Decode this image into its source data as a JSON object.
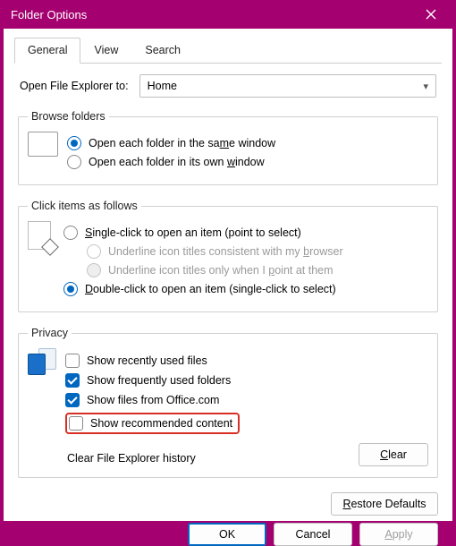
{
  "window": {
    "title": "Folder Options"
  },
  "tabs": {
    "general": "General",
    "view": "View",
    "search": "Search",
    "active": 0
  },
  "open_row": {
    "label": "Open File Explorer to:",
    "value": "Home"
  },
  "browse": {
    "legend": "Browse folders",
    "same_pre": "Open each folder in the sa",
    "same_u": "m",
    "same_post": "e window",
    "own_pre": "Open each folder in its own ",
    "own_u": "w",
    "own_post": "indow",
    "selected": "same"
  },
  "click": {
    "legend": "Click items as follows",
    "single_u": "S",
    "single_post": "ingle-click to open an item (point to select)",
    "ul_browser_pre": "Underline icon titles consistent with my ",
    "ul_browser_u": "b",
    "ul_browser_post": "rowser",
    "ul_point_pre": "Underline icon titles only when I ",
    "ul_point_u": "p",
    "ul_point_post": "oint at them",
    "double_u": "D",
    "double_post": "ouble-click to open an item (single-click to select)",
    "selected": "double"
  },
  "privacy": {
    "legend": "Privacy",
    "recent": "Show recently used files",
    "frequent": "Show frequently used folders",
    "office": "Show files from Office.com",
    "recommended": "Show recommended content",
    "checked": {
      "recent": false,
      "frequent": true,
      "office": true,
      "recommended": false
    },
    "clear_label": "Clear File Explorer history",
    "clear_btn_u": "C",
    "clear_btn_post": "lear"
  },
  "restore": {
    "u": "R",
    "post": "estore Defaults"
  },
  "buttons": {
    "ok": "OK",
    "cancel": "Cancel",
    "apply_u": "A",
    "apply_post": "pply"
  }
}
